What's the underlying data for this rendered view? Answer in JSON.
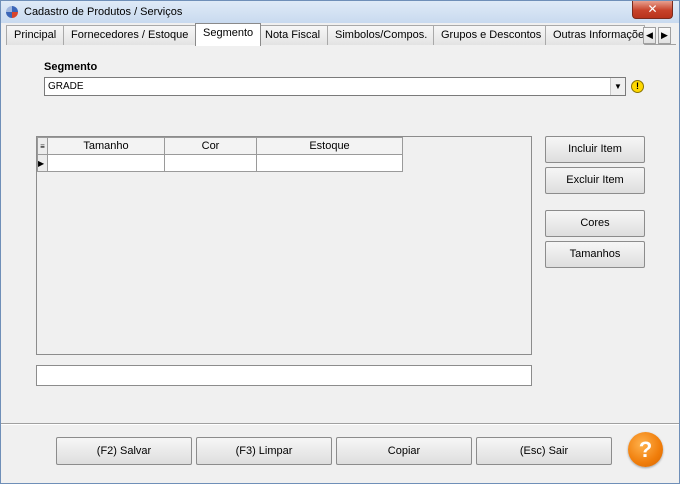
{
  "window": {
    "title": "Cadastro de Produtos / Serviços",
    "close_glyph": "✕"
  },
  "tabs": [
    {
      "label": "Principal"
    },
    {
      "label": "Fornecedores / Estoque"
    },
    {
      "label": "Segmento",
      "active": true
    },
    {
      "label": "Nota Fiscal"
    },
    {
      "label": "Simbolos/Compos."
    },
    {
      "label": "Grupos e Descontos"
    },
    {
      "label": "Outras Informações"
    }
  ],
  "tab_scroll": {
    "left_glyph": "◀",
    "right_glyph": "▶"
  },
  "segmento": {
    "label": "Segmento",
    "value": "GRADE",
    "dropdown_glyph": "▼",
    "warning_glyph": "!"
  },
  "grid": {
    "corner_glyph": "≡",
    "row_indicator_glyph": "▶",
    "columns": [
      "Tamanho",
      "Cor",
      "Estoque"
    ],
    "rows": [
      [
        "",
        "",
        ""
      ]
    ]
  },
  "side_buttons": {
    "incluir": "Incluir Item",
    "excluir": "Excluir Item",
    "cores": "Cores",
    "tamanhos": "Tamanhos"
  },
  "bottom_buttons": {
    "salvar": "(F2) Salvar",
    "limpar": "(F3) Limpar",
    "copiar": "Copiar",
    "sair": "(Esc) Sair"
  },
  "help": {
    "glyph": "?"
  },
  "colors": {
    "help_orange": "#f07d0a",
    "warning_yellow": "#ffd800",
    "close_red": "#c7422a"
  }
}
